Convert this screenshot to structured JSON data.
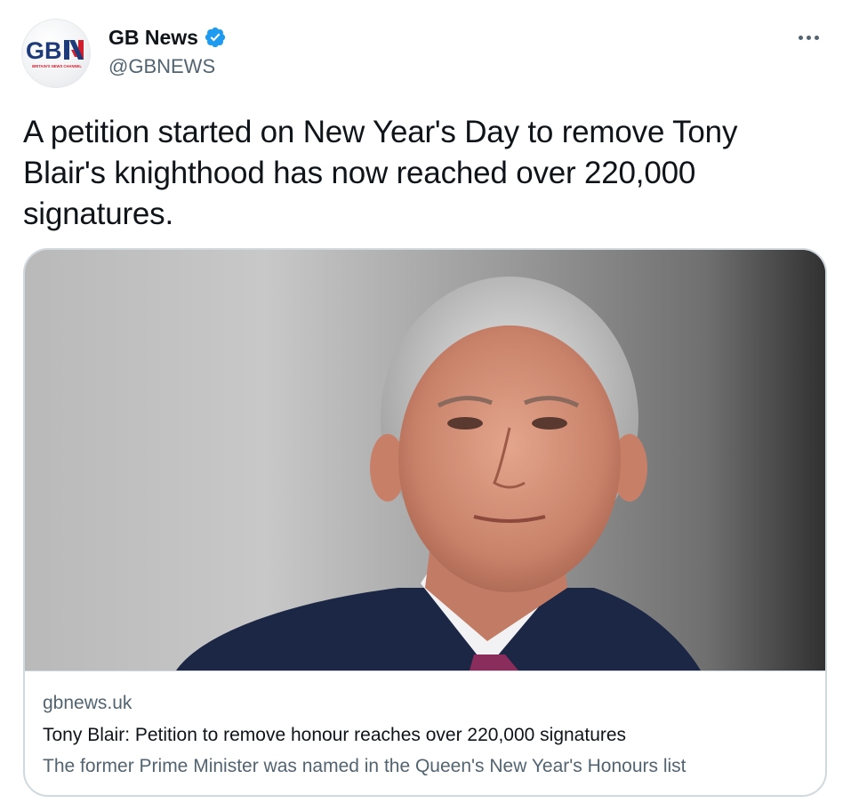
{
  "author": {
    "display_name": "GB News",
    "handle": "@GBNEWS",
    "verified": true,
    "avatar_logo_text": "GBN",
    "avatar_logo_tagline": "BRITAIN'S NEWS CHANNEL"
  },
  "menu": {
    "icon": "more-horizontal-icon"
  },
  "tweet": {
    "text": "A petition started on New Year's Day to remove Tony Blair's knighthood has now reached over 220,000 signatures."
  },
  "link_card": {
    "domain": "gbnews.uk",
    "title": "Tony Blair: Petition to remove honour reaches over 220,000 signatures",
    "description": "The former Prime Minister was named in the Queen's New Year's Honours list"
  },
  "colors": {
    "text_primary": "#0f1419",
    "text_secondary": "#536471",
    "verified_blue": "#1d9bf0",
    "card_border": "#cfd9de",
    "logo_blue": "#1e3a78",
    "logo_red": "#d21f2e"
  }
}
